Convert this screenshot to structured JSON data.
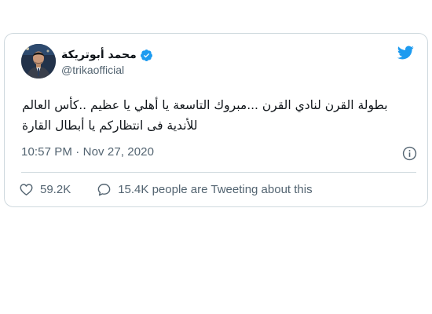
{
  "tweet": {
    "author": {
      "display_name": "محمد أبوتريكة",
      "handle": "@trikaofficial",
      "verified": true,
      "avatar_icon": "profile-photo"
    },
    "text_lines": [
      "بطولة القرن لنادي القرن ...مبروك التاسعة يا أهلي يا عظيم ..كأس العالم",
      "للأندية فى انتظاركم يا أبطال القارة"
    ],
    "timestamp": "10:57 PM · Nov 27, 2020",
    "likes_count": "59.2K",
    "retweet_text": "15.4K people are Tweeting about this",
    "icons": {
      "brand": "twitter-bird-icon",
      "verified": "verified-badge-icon",
      "info": "info-icon",
      "like": "heart-icon",
      "reply": "speech-bubble-icon"
    },
    "colors": {
      "brand_blue": "#1d9bf0",
      "text_primary": "#0f1419",
      "text_secondary": "#536471",
      "border": "#cfd9de"
    }
  }
}
